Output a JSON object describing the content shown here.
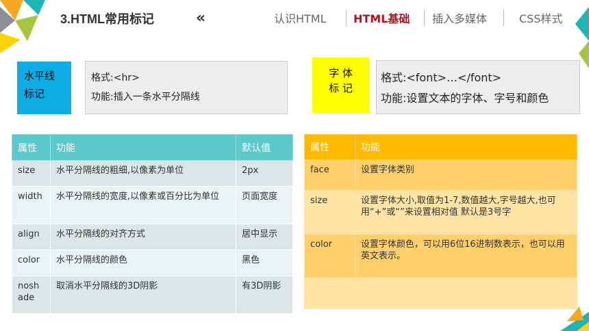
{
  "header": {
    "title": "3.HTML常用标记",
    "back_glyph": "«",
    "nav": [
      "认识HTML",
      "HTML基础",
      "插入多媒体",
      "CSS样式"
    ],
    "active_index": 1
  },
  "hr_tag": {
    "badge_line1": "水平线",
    "badge_line2": "标记",
    "format": "格式:<hr>",
    "function": "功能:插入一条水平分隔线"
  },
  "font_tag": {
    "badge_line1": "字 体",
    "badge_line2": "标 记",
    "format": "格式:<font>…</font>",
    "function": "功能:设置文本的字体、字号和颜色"
  },
  "hr_table": {
    "headers": [
      "属性",
      "功能",
      "默认值"
    ],
    "rows": [
      [
        "size",
        "水平分隔线的粗细,以像素为单位",
        "2px"
      ],
      [
        "width",
        "水平分隔线的宽度,以像素或百分比为单位",
        "页面宽度"
      ],
      [
        "align",
        "水平分隔线的对齐方式",
        "居中显示"
      ],
      [
        "color",
        "水平分隔线的颜色",
        "黑色"
      ],
      [
        "noshade",
        "取消水平分隔线的3D阴影",
        "有3D阴影"
      ]
    ]
  },
  "font_table": {
    "headers": [
      "属性",
      "功能"
    ],
    "rows": [
      [
        "face",
        "设置字体类别"
      ],
      [
        "size",
        "设置字体大小,取值为1-7,数值越大,字号越大,也可用“+”或“”来设置相对值 默认是3号字"
      ],
      [
        "color",
        "设置字体颜色，可以用6位16进制数表示，也可以用英文表示。"
      ],
      [
        "",
        ""
      ]
    ]
  },
  "colors": {
    "accent_red": "#b0121b",
    "badge_blue": "#0dace5",
    "badge_yellow": "#ffff00",
    "teal_header": "#5bc8cb",
    "orange_header": "#ffb900"
  }
}
